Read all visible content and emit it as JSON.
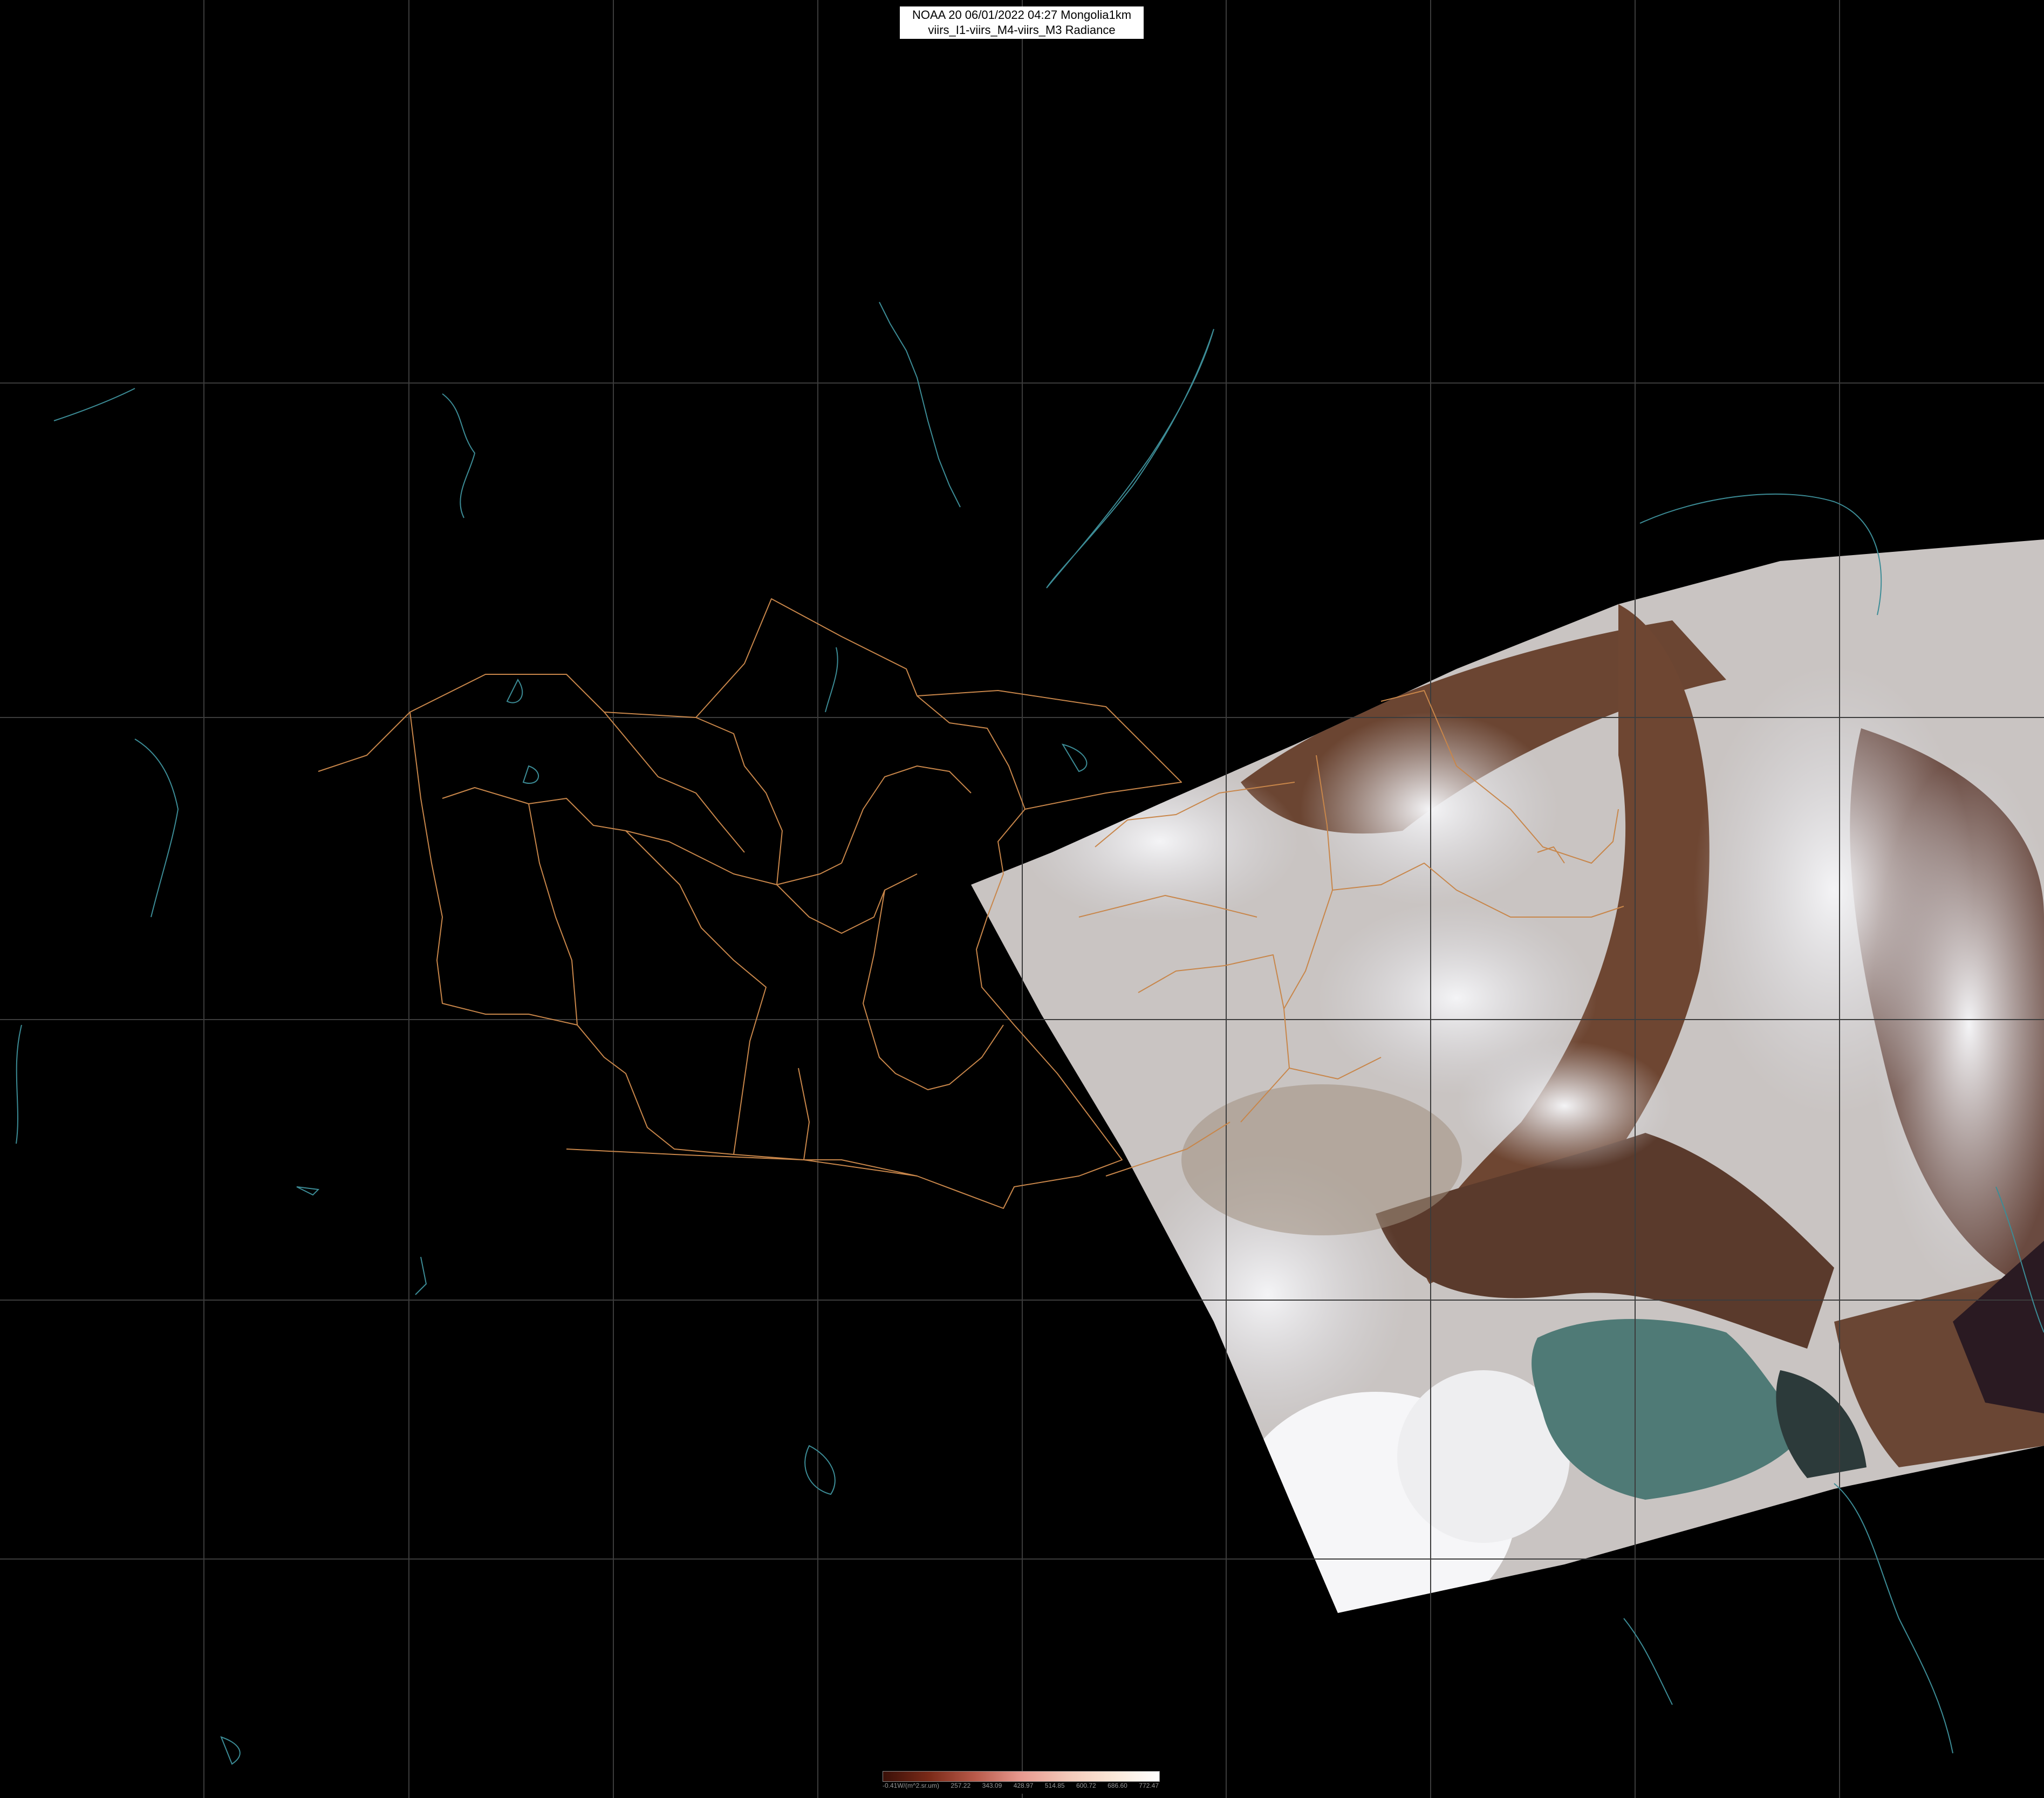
{
  "header": {
    "title_line1": "NOAA 20 06/01/2022 04:27 Mongolia1km",
    "title_line2": "viirs_I1-viirs_M4-viirs_M3 Radiance"
  },
  "colorbar": {
    "labels": [
      "-0.41W/(m^2.sr.um)",
      "257.22",
      "343.09",
      "428.97",
      "514.85",
      "600.72",
      "686.60",
      "772.47"
    ],
    "colors": [
      "#3a1008",
      "#7a2a18",
      "#b85a4a",
      "#e89a90",
      "#f3c8b8",
      "#fbe8d8",
      "#ffffff"
    ]
  },
  "colors": {
    "background": "#000000",
    "graticule": "#3c3c3c",
    "borders": "#c8864a",
    "coastline": "#3c8c96",
    "snow": "#e6e6ea",
    "land_brown": "#6e4a36",
    "sea_teal": "#5c8884"
  }
}
